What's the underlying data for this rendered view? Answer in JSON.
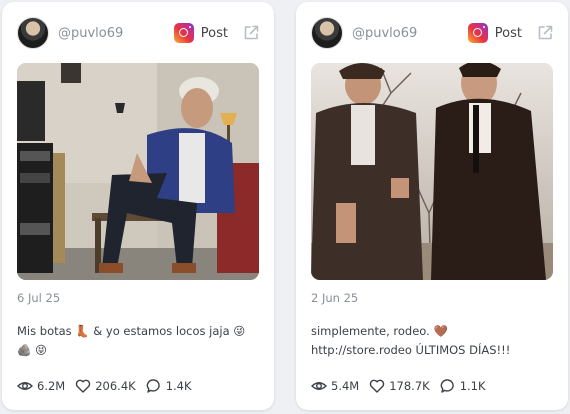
{
  "posts": [
    {
      "username": "@puvlo69",
      "platform_icon": "instagram-icon",
      "post_type_label": "Post",
      "external_icon": "external-link-icon",
      "image_description_icon": "photo",
      "date": "6 Jul 25",
      "caption": "Mis botas 👢 & yo estamos locos jaja 😜\n🪨 😝",
      "stats": {
        "views": "6.2M",
        "likes": "206.4K",
        "comments": "1.4K"
      }
    },
    {
      "username": "@puvlo69",
      "platform_icon": "instagram-icon",
      "post_type_label": "Post",
      "external_icon": "external-link-icon",
      "image_description_icon": "photo",
      "date": "2 Jun 25",
      "caption": "simplemente, rodeo. 🤎\nhttp://store.rodeo ÚLTIMOS DÍAS!!!",
      "stats": {
        "views": "5.4M",
        "likes": "178.7K",
        "comments": "1.1K"
      }
    }
  ],
  "colors": {
    "muted": "#8a8f98",
    "text": "#3d4048",
    "card": "#ffffff",
    "bg": "#eef0f3"
  }
}
